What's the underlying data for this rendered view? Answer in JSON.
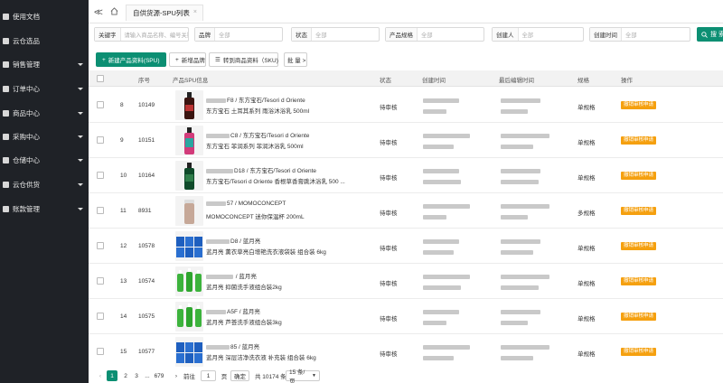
{
  "sidebar": {
    "items": [
      {
        "label": "使用文档",
        "has_children": false
      },
      {
        "label": "云仓选品",
        "has_children": false
      },
      {
        "label": "销售管理",
        "has_children": true
      },
      {
        "label": "订单中心",
        "has_children": true
      },
      {
        "label": "商品中心",
        "has_children": true
      },
      {
        "label": "采购中心",
        "has_children": true
      },
      {
        "label": "仓储中心",
        "has_children": true
      },
      {
        "label": "云仓供货",
        "has_children": true
      },
      {
        "label": "账款管理",
        "has_children": true
      }
    ]
  },
  "tabs": [
    {
      "label": "自供货源-SPU列表"
    }
  ],
  "filters": {
    "keyword": {
      "label": "关键字",
      "placeholder": "请输入商品名称、编号关键字"
    },
    "brand": {
      "label": "品牌",
      "value": "全部"
    },
    "status": {
      "label": "状态",
      "value": "全部"
    },
    "spec": {
      "label": "产品规格",
      "value": "全部"
    },
    "creator": {
      "label": "创建人",
      "value": "全部"
    },
    "create_time": {
      "label": "创建时间",
      "value": "全部"
    },
    "search_label": "搜 索"
  },
  "actions": {
    "new_spu": "新建产品资料(SPU)",
    "new_brand": "新增品牌",
    "transfer_sku": "转到商品资料（SKU)",
    "batch": "批 量 >"
  },
  "table": {
    "headers": {
      "seq": "序号",
      "product": "产品SPU信息",
      "status": "状态",
      "created": "创建时间",
      "edited": "最后编辑时间",
      "spec": "规格",
      "action": "操作"
    },
    "action_label": "撤销审核申请",
    "rows": [
      {
        "idx": "8",
        "seq": "10149",
        "line1": "F8 / 东方宝石/Tesori d Oriente",
        "line2": "东方宝石 土耳其系列 雨浴沐浴乳 500ml",
        "status": "待审核",
        "spec": "单规格",
        "thumb": "bottle-dark"
      },
      {
        "idx": "9",
        "seq": "10151",
        "line1": "C8 / 东方宝石/Tesori d Oriente",
        "line2": "东方宝石 菲润系列 菲润沐浴乳 500ml",
        "status": "待审核",
        "spec": "单规格",
        "thumb": "bottle-pink"
      },
      {
        "idx": "10",
        "seq": "10164",
        "line1": "D18 / 东方宝石/Tesori d Oriente",
        "line2": "东方宝石/Tesori d Oriente 香根草香膏跳沐浴乳  500 ...",
        "status": "待审核",
        "spec": "单规格",
        "thumb": "bottle-green"
      },
      {
        "idx": "11",
        "seq": "8931",
        "line1": "57 / MOMOCONCEPT",
        "line2": "MOMOCONCEPT  迷你保温杯 200mL",
        "status": "待审核",
        "spec": "多规格",
        "thumb": "cup"
      },
      {
        "idx": "12",
        "seq": "10578",
        "line1": "D8 / 蓝月亮",
        "line2": "蓝月亮 薰衣草亮白增艳洗衣液袋装 组合装 6kg",
        "status": "待审核",
        "spec": "单规格",
        "thumb": "blue-bags"
      },
      {
        "idx": "13",
        "seq": "10574",
        "line1": " / 蓝月亮",
        "line2": "蓝月亮 抑菌洗手液组合装2kg",
        "status": "待审核",
        "spec": "单规格",
        "thumb": "green-bottles"
      },
      {
        "idx": "14",
        "seq": "10575",
        "line1": "A5F / 蓝月亮",
        "line2": "蓝月亮 芦荟洗手液组合装3kg",
        "status": "待审核",
        "spec": "单规格",
        "thumb": "green-bottles"
      },
      {
        "idx": "15",
        "seq": "10577",
        "line1": "85 / 蓝月亮",
        "line2": "蓝月亮 深层洁净洗衣液 补充装 组合装 6kg",
        "status": "待审核",
        "spec": "单规格",
        "thumb": "blue-bags"
      }
    ]
  },
  "pagination": {
    "pages": [
      "1",
      "2",
      "3",
      "...",
      "679"
    ],
    "goto_label": "前往",
    "goto_value": "1",
    "page_unit": "页",
    "confirm_label": "确定",
    "total_label": "共 10174 条",
    "page_size": "15 条/页"
  },
  "colors": {
    "sidebar_bg": "#1f2227",
    "primary": "#0c8f73",
    "warning": "#f5a00f"
  }
}
